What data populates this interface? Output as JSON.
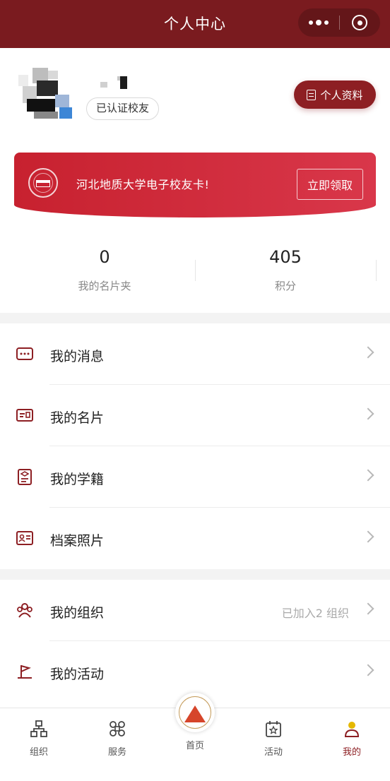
{
  "nav": {
    "title": "个人中心"
  },
  "profile": {
    "badge": "已认证校友",
    "profile_button": "个人资料"
  },
  "card": {
    "text": "河北地质大学电子校友卡!",
    "claim_button": "立即领取"
  },
  "stats": [
    {
      "value": "0",
      "label": "我的名片夹"
    },
    {
      "value": "405",
      "label": "积分"
    }
  ],
  "menu_group1": [
    {
      "label": "我的消息",
      "icon": "message-icon"
    },
    {
      "label": "我的名片",
      "icon": "business-card-icon"
    },
    {
      "label": "我的学籍",
      "icon": "student-record-icon"
    },
    {
      "label": "档案照片",
      "icon": "archive-photo-icon"
    }
  ],
  "menu_group2": [
    {
      "label": "我的组织",
      "icon": "organization-icon",
      "extra": "已加入2 组织"
    },
    {
      "label": "我的活动",
      "icon": "flag-icon"
    }
  ],
  "tabbar": [
    {
      "label": "组织",
      "icon": "org-chart-icon"
    },
    {
      "label": "服务",
      "icon": "command-icon"
    },
    {
      "label": "首页",
      "icon": "school-emblem-icon"
    },
    {
      "label": "活动",
      "icon": "calendar-star-icon"
    },
    {
      "label": "我的",
      "icon": "user-icon",
      "active": true
    }
  ],
  "colors": {
    "brand": "#7a1b1f",
    "card": "#c7212f",
    "active_tab": "#8d1f23"
  }
}
